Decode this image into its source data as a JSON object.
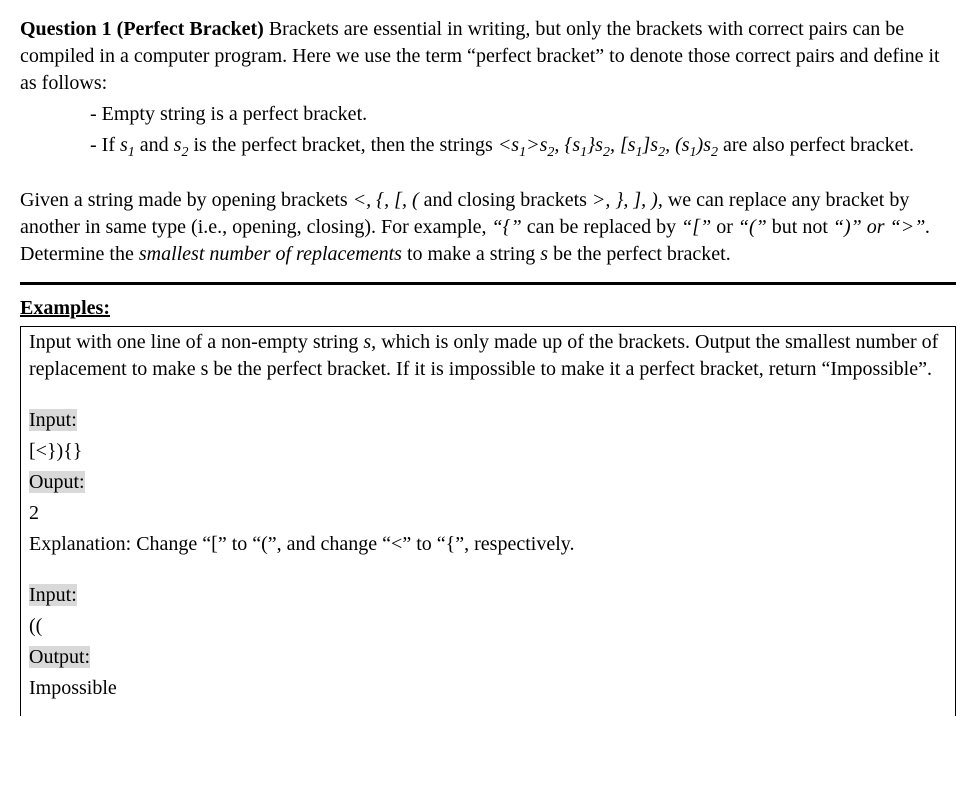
{
  "question": {
    "heading": "Question 1 (Perfect Bracket)",
    "intro_after_heading": " Brackets are essential in writing, but only the brackets with correct pairs can be compiled in a computer program. Here we use the term “perfect bracket” to denote those correct pairs and define it as follows:",
    "rule1": "- Empty string is a perfect bracket.",
    "rule2_a": "- If ",
    "rule2_s1": "s",
    "rule2_sub1": "1",
    "rule2_and": " and ",
    "rule2_s2": "s",
    "rule2_sub2": "2",
    "rule2_b": " is the perfect bracket, then the strings ",
    "rule2_pat_open1": "<s",
    "rule2_pat_close1": ">s",
    "rule2_sep": ", ",
    "rule2_pat_open2": "{s",
    "rule2_pat_close2": "}s",
    "rule2_pat_open3": "[s",
    "rule2_pat_close3": "]s",
    "rule2_pat_open4": "(s",
    "rule2_pat_close4": ")s",
    "rule2_tail": " are also",
    "rule2_tail2": "perfect bracket.",
    "p2_a": "Given a string made by opening brackets ",
    "p2_open": "<, {, [, (",
    "p2_b": " and closing brackets ",
    "p2_close": ">, }, ], ),",
    "p2_c": " we can replace any bracket by another in same type (i.e., opening, closing). For example, ",
    "p2_ex1": "“{”",
    "p2_d": " can be replaced by ",
    "p2_ex2": "“[”",
    "p2_or1": " or ",
    "p2_ex3": "“(”",
    "p2_but": " but not ",
    "p2_ex4": "“)” or “>”.",
    "p2_e": " Determine the ",
    "p2_em": "smallest number of replacements",
    "p2_f": " to make a string ",
    "p2_s": "s",
    "p2_g": " be the perfect bracket."
  },
  "examples": {
    "heading": "Examples:",
    "desc_a": "Input with one line of a non-empty string ",
    "desc_s": "s,",
    "desc_b": "  which is only made up of the brackets. Output the smallest number of replacement to make s be the perfect bracket. If it is impossible to make it a perfect bracket, return “Impossible”.",
    "ex1": {
      "input_label": "Input:",
      "input_val": "[<}){}",
      "output_label": "Ouput:",
      "output_val": "2",
      "explanation": "Explanation: Change “[” to “(”, and change “<” to “{”, respectively."
    },
    "ex2": {
      "input_label": "Input:",
      "input_val": "((",
      "output_label": "Output:",
      "output_val": "Impossible"
    }
  }
}
